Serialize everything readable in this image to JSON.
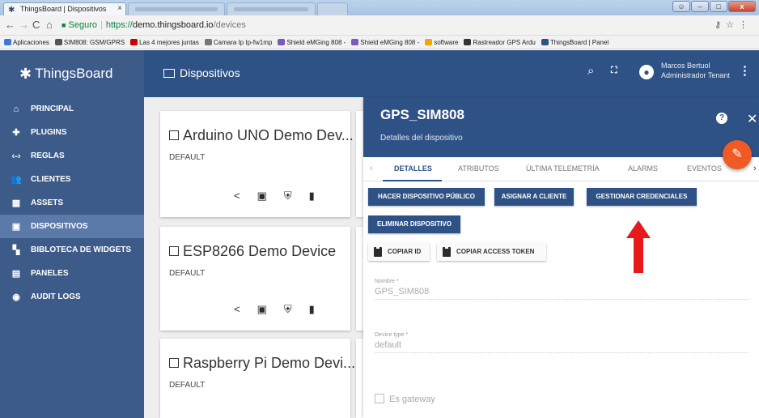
{
  "browser": {
    "active_tab_title": "ThingsBoard | Dispositivos",
    "address": {
      "secure_label": "Seguro",
      "scheme": "https://",
      "host": "demo.thingsboard.io",
      "path": "/devices"
    },
    "bookmarks": [
      {
        "label": "Aplicaciones",
        "color": "#3c78d8"
      },
      {
        "label": "SIM808: GSM/GPRS",
        "color": "#555555"
      },
      {
        "label": "Las 4 mejores juntas",
        "color": "#cc0000"
      },
      {
        "label": "Camara Ip Ip-fw1mp",
        "color": "#777777"
      },
      {
        "label": "Shield eMGing 808 -",
        "color": "#7e57c2"
      },
      {
        "label": "Shield eMGing 808 -",
        "color": "#7e57c2"
      },
      {
        "label": "software",
        "color": "#f2a600"
      },
      {
        "label": "Rastreador GPS Ardu",
        "color": "#333333"
      },
      {
        "label": "ThingsBoard | Panel",
        "color": "#2f5286"
      }
    ]
  },
  "brand": {
    "name": "ThingsBoard"
  },
  "sidebar": {
    "items": [
      {
        "label": "PRINCIPAL",
        "icon": "home-icon",
        "glyph": "⌂",
        "active": false
      },
      {
        "label": "PLUGINS",
        "icon": "plugin-icon",
        "glyph": "✚",
        "active": false
      },
      {
        "label": "REGLAS",
        "icon": "rules-icon",
        "glyph": "‹-›",
        "active": false
      },
      {
        "label": "CLIENTES",
        "icon": "clients-icon",
        "glyph": "👥",
        "active": false
      },
      {
        "label": "ASSETS",
        "icon": "assets-icon",
        "glyph": "▦",
        "active": false
      },
      {
        "label": "DISPOSITIVOS",
        "icon": "devices-icon",
        "glyph": "▣",
        "active": true
      },
      {
        "label": "BIBLOTECA DE WIDGETS",
        "icon": "widgets-icon",
        "glyph": "▚",
        "active": false
      },
      {
        "label": "PANELES",
        "icon": "dashboards-icon",
        "glyph": "▤",
        "active": false
      },
      {
        "label": "AUDIT LOGS",
        "icon": "audit-icon",
        "glyph": "◉",
        "active": false
      }
    ]
  },
  "header": {
    "page_title": "Dispositivos",
    "user_name": "Marcos Bertuol",
    "user_role": "Administrador Tenant"
  },
  "devices": [
    {
      "name": "Arduino UNO Demo Dev...",
      "type": "DEFAULT"
    },
    {
      "name": "ESP8266 Demo Device",
      "type": "DEFAULT"
    },
    {
      "name": "Raspberry Pi Demo Devi...",
      "type": "DEFAULT"
    }
  ],
  "detail": {
    "title": "GPS_SIM808",
    "subtitle": "Detalles del dispositivo",
    "tabs": [
      "DETALLES",
      "ATRIBUTOS",
      "ÚLTIMA TELEMETRÍA",
      "ALARMS",
      "EVENTOS"
    ],
    "active_tab": "DETALLES",
    "buttons": {
      "make_public": "HACER DISPOSITIVO PÚBLICO",
      "assign_customer": "ASIGNAR A CLIENTE",
      "manage_credentials": "GESTIONAR CREDENCIALES",
      "delete": "ELIMINAR DISPOSITIVO",
      "copy_id": "COPIAR ID",
      "copy_token": "COPIAR ACCESS TOKEN"
    },
    "fields": {
      "name_label": "Nombre *",
      "name_value": "GPS_SIM808",
      "type_label": "Device type *",
      "type_value": "default",
      "gateway_label": "Es gateway"
    }
  },
  "colors": {
    "primary": "#2f5286",
    "sidebar": "#3d5b89",
    "fab": "#f05a24",
    "annotation_arrow": "#e8191c"
  }
}
